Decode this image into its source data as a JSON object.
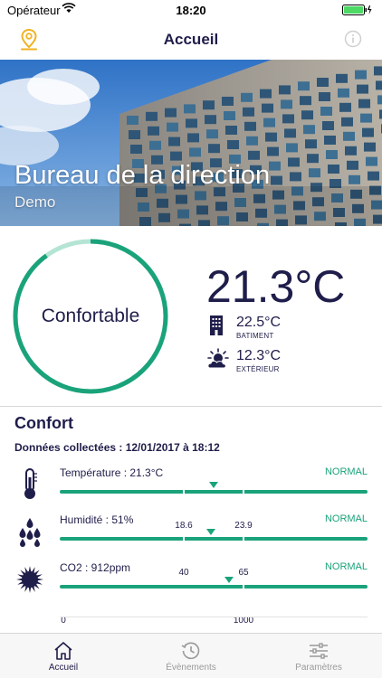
{
  "status_bar": {
    "carrier": "Opérateur",
    "time": "18:20"
  },
  "nav": {
    "title": "Accueil"
  },
  "building": {
    "name": "Bureau de la direction",
    "subtitle": "Demo"
  },
  "comfort": {
    "label": "Confortable",
    "ring_fraction": 0.9
  },
  "temperature": {
    "main": "21.3°C",
    "building_value": "22.5°C",
    "building_label": "BATIMENT",
    "outside_value": "12.3°C",
    "outside_label": "EXTÉRIEUR"
  },
  "section": {
    "title": "Confort",
    "collected": "Données collectées : 12/01/2017 à 18:12"
  },
  "metrics": [
    {
      "label": "Température : 21.3°C",
      "status": "NORMAL",
      "ticks": [
        "18.6",
        "23.9"
      ],
      "marker": 0.5
    },
    {
      "label": "Humidité : 51%",
      "status": "NORMAL",
      "ticks": [
        "40",
        "65"
      ],
      "marker": 0.49
    },
    {
      "label": "CO2 : 912ppm",
      "status": "NORMAL",
      "ticks": [
        "0",
        "1000"
      ],
      "marker": 0.55
    }
  ],
  "tabs": [
    {
      "label": "Accueil",
      "icon": "home-icon",
      "active": true
    },
    {
      "label": "Évènements",
      "icon": "history-icon",
      "active": false
    },
    {
      "label": "Paramètres",
      "icon": "sliders-icon",
      "active": false
    }
  ],
  "colors": {
    "accent": "#1aa37a",
    "navy": "#1f1d4a",
    "pin": "#f0b323"
  }
}
